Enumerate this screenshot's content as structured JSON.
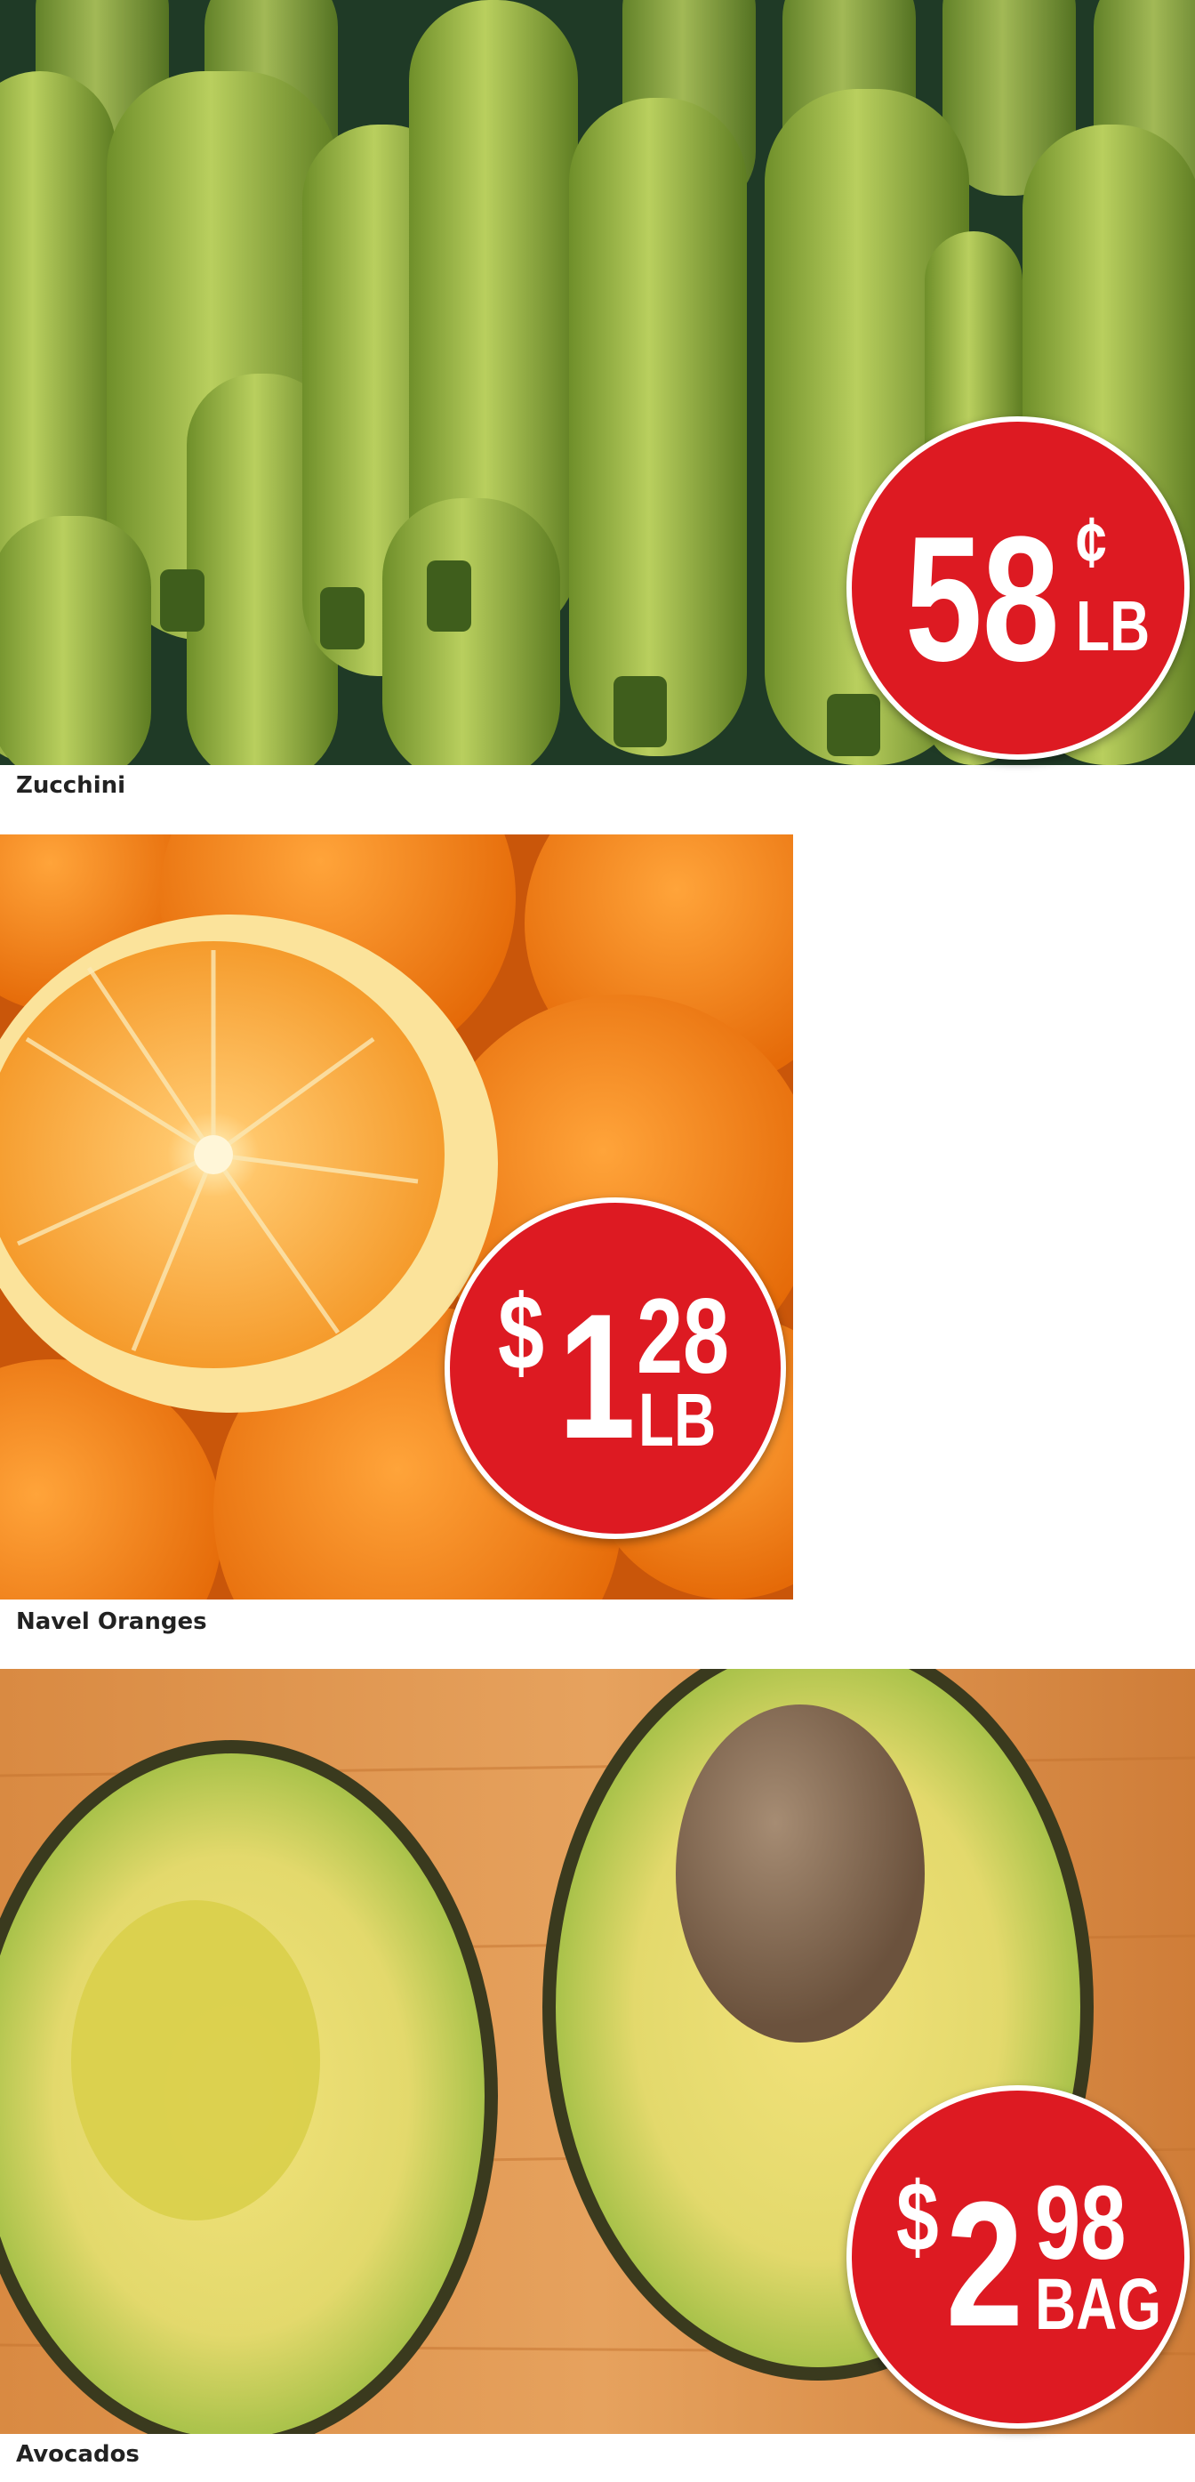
{
  "colors": {
    "badge_red": "#dd1a22",
    "badge_border": "#ffffff",
    "caption_text": "#222222"
  },
  "products": [
    {
      "name": "Zucchini",
      "image": "zucchini-photo",
      "price": {
        "dollar_sign": "",
        "main": "58",
        "cents": "¢",
        "unit": "LB"
      }
    },
    {
      "name": "Navel Oranges",
      "image": "navel-oranges-photo",
      "price": {
        "dollar_sign": "$",
        "main": "1",
        "cents": "28",
        "unit": "LB"
      }
    },
    {
      "name": "Avocados",
      "image": "avocados-photo",
      "price": {
        "dollar_sign": "$",
        "main": "2",
        "cents": "98",
        "unit": "BAG"
      }
    }
  ]
}
